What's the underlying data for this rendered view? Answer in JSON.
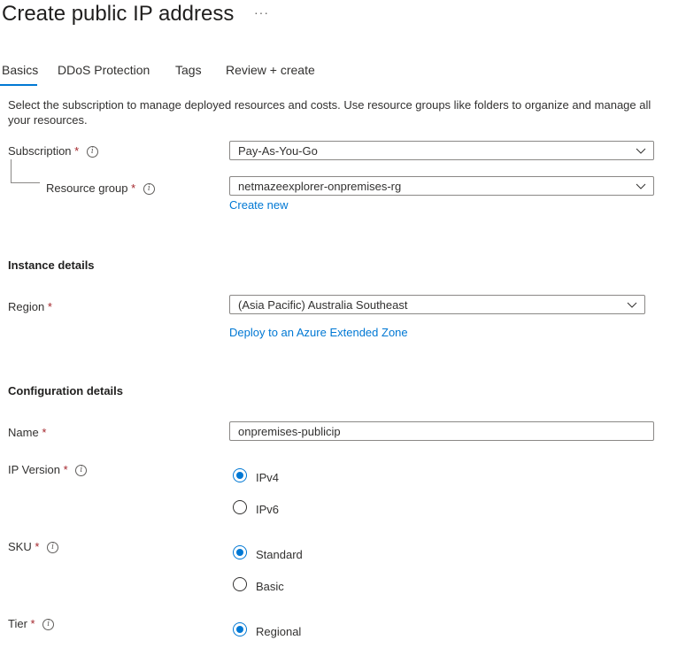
{
  "header": {
    "title": "Create public IP address",
    "more_label": "···"
  },
  "tabs": [
    {
      "label": "Basics",
      "active": true
    },
    {
      "label": "DDoS Protection"
    },
    {
      "label": "Tags"
    },
    {
      "label": "Review + create"
    }
  ],
  "intro_text": "Select the subscription to manage deployed resources and costs. Use resource groups like folders to organize and manage all your resources.",
  "project": {
    "subscription": {
      "label": "Subscription",
      "required": "*",
      "value": "Pay-As-You-Go"
    },
    "resource_group": {
      "label": "Resource group",
      "required": "*",
      "value": "netmazeexplorer-onpremises-rg",
      "create_new": "Create new"
    }
  },
  "instance": {
    "heading": "Instance details",
    "region": {
      "label": "Region",
      "required": "*",
      "value": "(Asia Pacific) Australia Southeast",
      "extended_zone_link": "Deploy to an Azure Extended Zone"
    }
  },
  "configuration": {
    "heading": "Configuration details",
    "name": {
      "label": "Name",
      "required": "*",
      "value": "onpremises-publicip"
    },
    "ip_version": {
      "label": "IP Version",
      "required": "*",
      "options": [
        "IPv4",
        "IPv6"
      ],
      "selected": "IPv4"
    },
    "sku": {
      "label": "SKU",
      "required": "*",
      "options": [
        "Standard",
        "Basic"
      ],
      "selected": "Standard"
    },
    "tier": {
      "label": "Tier",
      "required": "*",
      "options": [
        "Regional"
      ],
      "selected": "Regional"
    }
  },
  "icons": {
    "info": "info-icon",
    "dropdown": "chevron-down-icon"
  },
  "colors": {
    "accent": "#0078d4",
    "required": "#a4262c",
    "text": "#323130"
  }
}
